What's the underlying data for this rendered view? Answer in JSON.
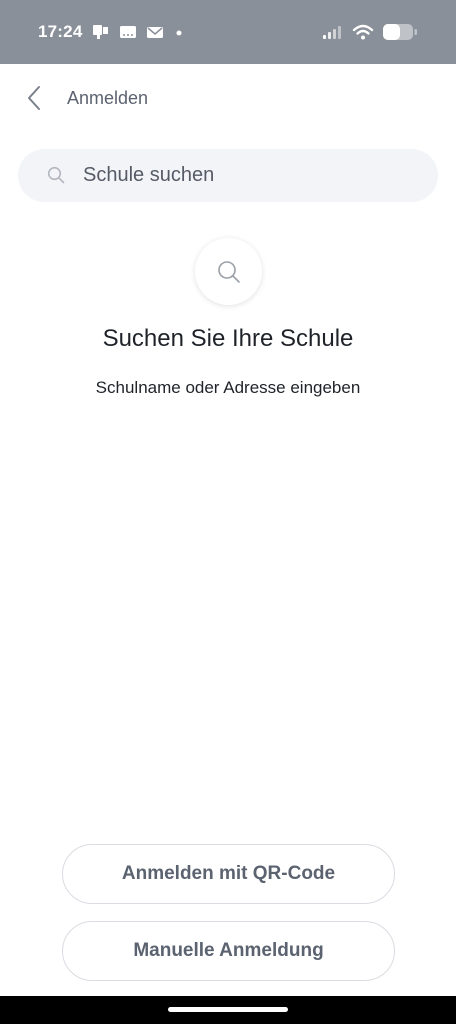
{
  "status_bar": {
    "time": "17:24",
    "left_icons": [
      "notification-icon",
      "message-icon",
      "mail-icon",
      "dot-icon"
    ],
    "right_icons": [
      "signal-icon",
      "wifi-icon",
      "battery-icon"
    ]
  },
  "header": {
    "title": "Anmelden",
    "back_icon": "chevron-left-icon"
  },
  "search": {
    "placeholder": "Schule suchen",
    "value": ""
  },
  "empty_state": {
    "icon": "search-icon",
    "title": "Suchen Sie Ihre Schule",
    "subtitle": "Schulname oder Adresse eingeben"
  },
  "actions": {
    "qr_label": "Anmelden mit QR-Code",
    "manual_label": "Manuelle Anmeldung"
  },
  "colors": {
    "status_bar": "#8a9099",
    "search_bg": "#f2f4f7",
    "button_text": "#5c6370",
    "border": "#d9dce1"
  }
}
